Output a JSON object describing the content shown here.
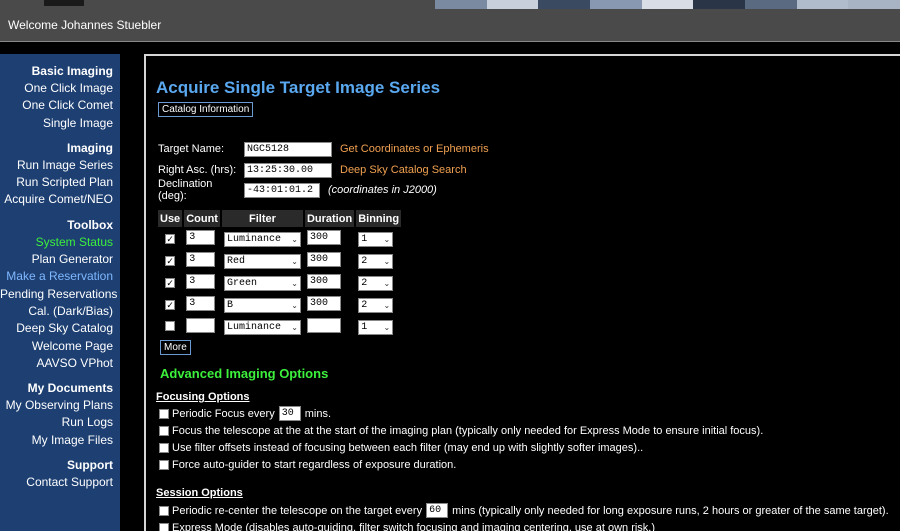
{
  "header": {
    "welcome": "Welcome Johannes Stuebler"
  },
  "sidebar": {
    "sections": [
      {
        "title": "Basic Imaging",
        "items": [
          {
            "label": "One Click Image"
          },
          {
            "label": "One Click Comet"
          },
          {
            "label": "Single Image"
          }
        ]
      },
      {
        "title": "Imaging",
        "items": [
          {
            "label": "Run Image Series"
          },
          {
            "label": "Run Scripted Plan"
          },
          {
            "label": "Acquire Comet/NEO"
          }
        ]
      },
      {
        "title": "Toolbox",
        "items": [
          {
            "label": "System Status",
            "color": "#3cf03c"
          },
          {
            "label": "Plan Generator"
          },
          {
            "label": "Make a Reservation",
            "color": "#7fb8ff"
          },
          {
            "label": "Pending Reservations"
          },
          {
            "label": "Cal. (Dark/Bias)"
          },
          {
            "label": "Deep Sky Catalog"
          },
          {
            "label": "Welcome Page"
          },
          {
            "label": "AAVSO VPhot"
          }
        ]
      },
      {
        "title": "My Documents",
        "items": [
          {
            "label": "My Observing Plans"
          },
          {
            "label": "Run Logs"
          },
          {
            "label": "My Image Files"
          }
        ]
      },
      {
        "title": "Support",
        "items": [
          {
            "label": "Contact Support"
          }
        ]
      }
    ]
  },
  "main": {
    "title": "Acquire Single Target Image Series",
    "catalog_button": "Catalog Information",
    "target_name_label": "Target Name:",
    "target_name_value": "NGC5128",
    "get_coordinates_link": "Get Coordinates or Ephemeris",
    "ra_label": "Right Asc. (hrs):",
    "ra_value": "13:25:30.00",
    "catalog_search_link": "Deep Sky Catalog Search",
    "dec_label": "Declination (deg):",
    "dec_value": "-43:01:01.2",
    "coord_note": "(coordinates in J2000)",
    "table_headers": {
      "use": "Use",
      "count": "Count",
      "filter": "Filter",
      "duration": "Duration",
      "binning": "Binning"
    },
    "rows": [
      {
        "checked": "✓",
        "count": "3",
        "filter": "Luminance",
        "duration": "300",
        "binning": "1"
      },
      {
        "checked": "✓",
        "count": "3",
        "filter": "Red",
        "duration": "300",
        "binning": "2"
      },
      {
        "checked": "✓",
        "count": "3",
        "filter": "Green",
        "duration": "300",
        "binning": "2"
      },
      {
        "checked": "✓",
        "count": "3",
        "filter": "B",
        "duration": "300",
        "binning": "2"
      },
      {
        "checked": "",
        "count": "",
        "filter": "Luminance",
        "duration": "",
        "binning": "1"
      }
    ],
    "more_button": "More",
    "advanced_title": "Advanced Imaging Options",
    "focusing_title": "Focusing Options",
    "periodic_focus_pre": "Periodic Focus every",
    "periodic_focus_value": "30",
    "periodic_focus_post": "mins.",
    "focus_start": "Focus the telescope at the at the start of the imaging plan (typically only needed for Express Mode to ensure initial focus).",
    "filter_offsets": "Use filter offsets instead of focusing between each filter (may end up with slightly softer images)..",
    "force_autoguider": "Force auto-guider to start regardless of exposure duration.",
    "session_title": "Session Options",
    "recenter_pre": "Periodic re-center the telescope on the target every",
    "recenter_value": "60",
    "recenter_post": "mins (typically only needed for long exposure runs, 2 hours or greater of the same target).",
    "express_mode": "Express Mode (disables auto-guiding, filter switch focusing and imaging centering, use at own risk.)"
  }
}
